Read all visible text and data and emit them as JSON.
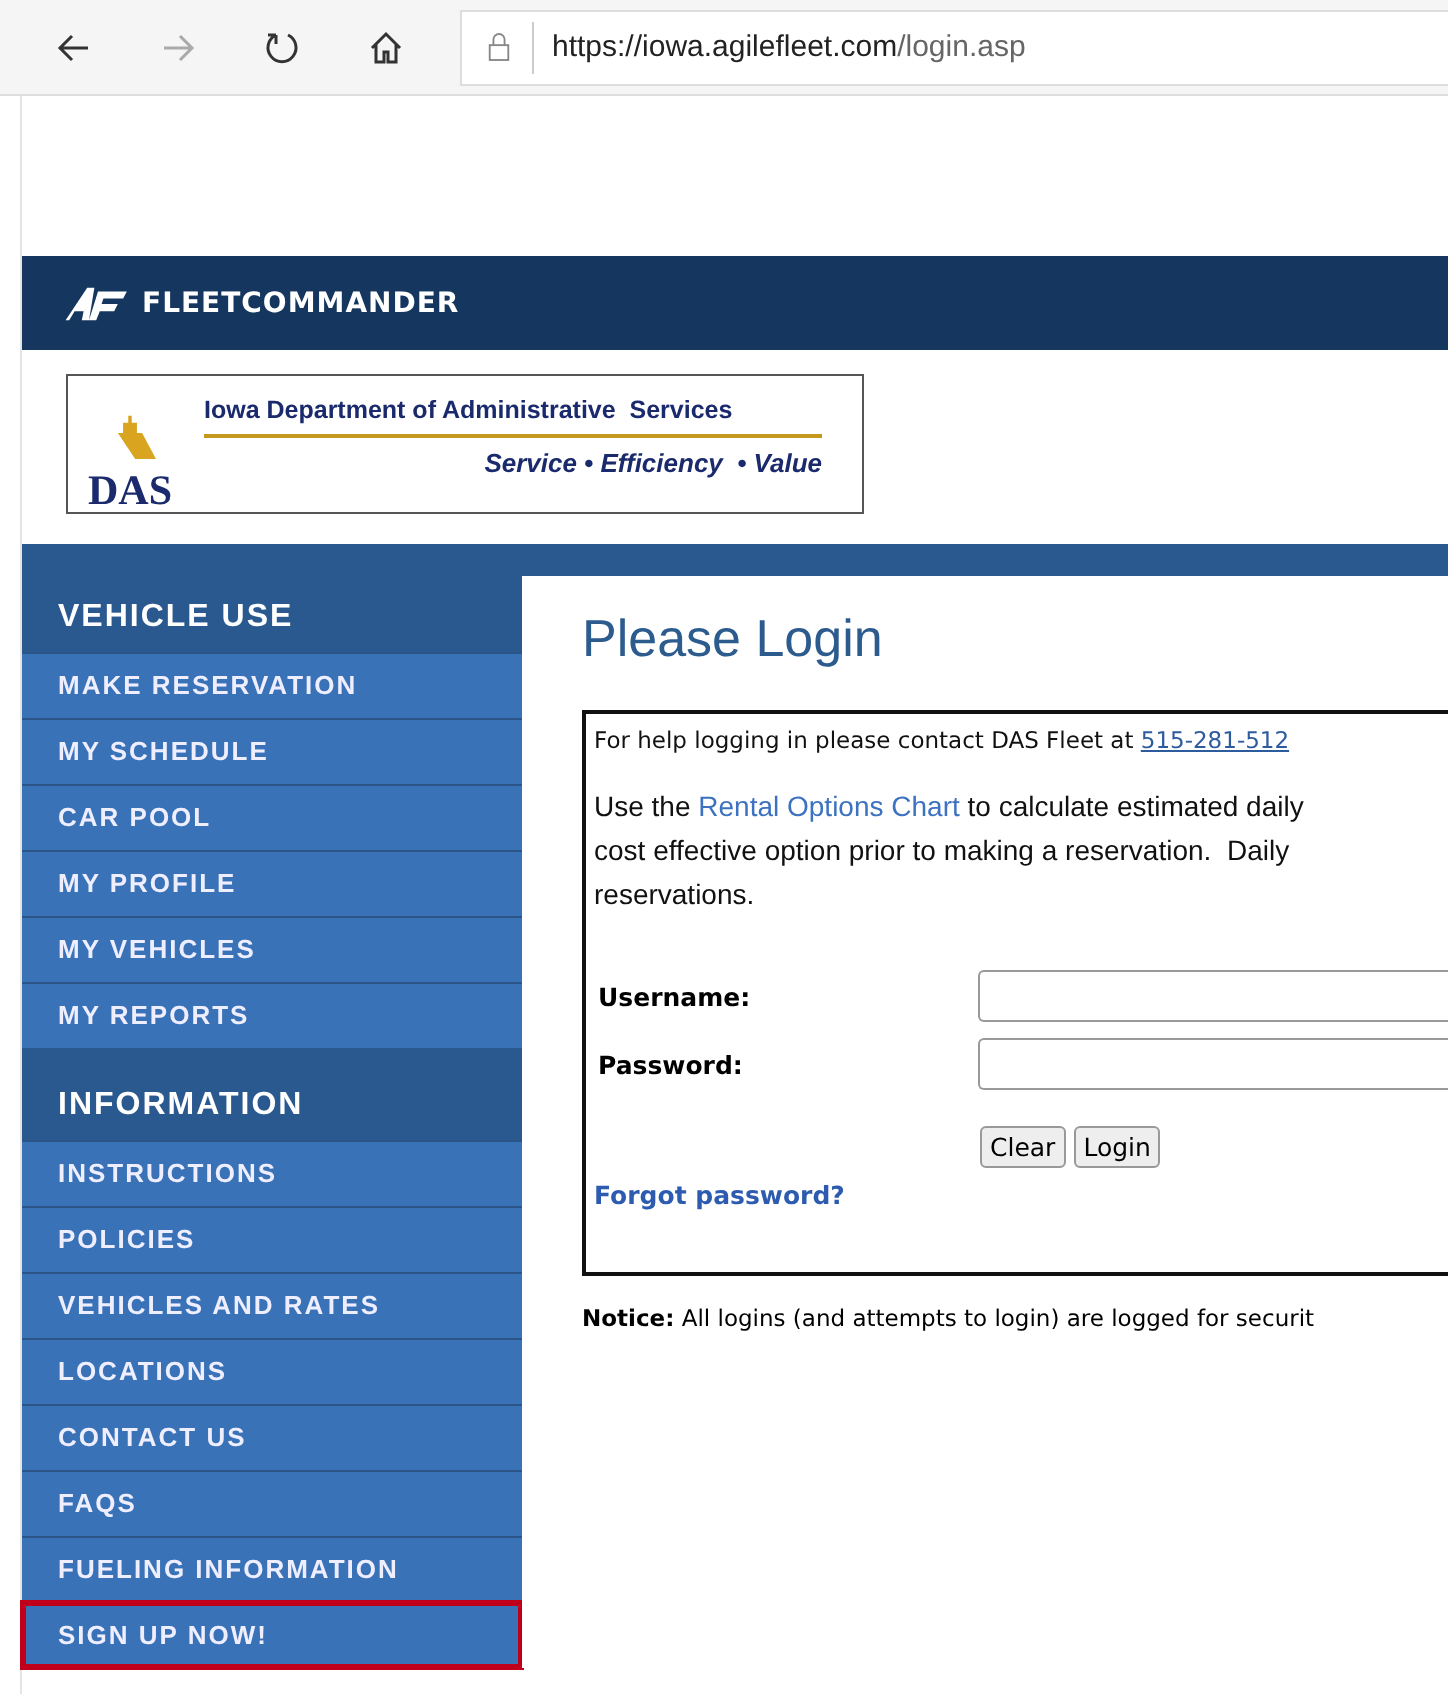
{
  "browser": {
    "url_host": "https://iowa.agilefleet.com",
    "url_path": "/login.asp"
  },
  "banner": {
    "brand": "FLEETCOMMANDER"
  },
  "agency_logo": {
    "mark": "DAS",
    "name": "Iowa Department of Administrative  Services",
    "motto": "Service • Efficiency  • Value"
  },
  "sidebar": {
    "sections": [
      {
        "heading": "VEHICLE USE",
        "items": [
          {
            "label": "MAKE RESERVATION",
            "highlighted": false
          },
          {
            "label": "MY SCHEDULE",
            "highlighted": false
          },
          {
            "label": "CAR POOL",
            "highlighted": false
          },
          {
            "label": "MY PROFILE",
            "highlighted": false
          },
          {
            "label": "MY VEHICLES",
            "highlighted": false
          },
          {
            "label": "MY REPORTS",
            "highlighted": false
          }
        ]
      },
      {
        "heading": "INFORMATION",
        "items": [
          {
            "label": "INSTRUCTIONS",
            "highlighted": false
          },
          {
            "label": "POLICIES",
            "highlighted": false
          },
          {
            "label": "VEHICLES AND RATES",
            "highlighted": false
          },
          {
            "label": "LOCATIONS",
            "highlighted": false
          },
          {
            "label": "CONTACT US",
            "highlighted": false
          },
          {
            "label": "FAQS",
            "highlighted": false
          },
          {
            "label": "FUELING INFORMATION",
            "highlighted": false
          },
          {
            "label": "SIGN UP NOW!",
            "highlighted": true
          }
        ]
      }
    ]
  },
  "login": {
    "title": "Please Login",
    "help_text": "For help logging in please contact DAS Fleet at ",
    "help_phone": "515-281-512",
    "info_before": "Use the ",
    "info_link": "Rental Options Chart",
    "info_after": " to calculate estimated daily",
    "info_lines": [
      "cost effective option prior to making a reservation.  Daily",
      "reservations."
    ],
    "fields": [
      {
        "label": "Username:"
      },
      {
        "label": "Password:"
      }
    ],
    "buttons": [
      "Clear",
      "Login"
    ],
    "forgot": "Forgot password?",
    "notice": "**Notice:** All logins (and attempts to login) are logged for securit"
  }
}
